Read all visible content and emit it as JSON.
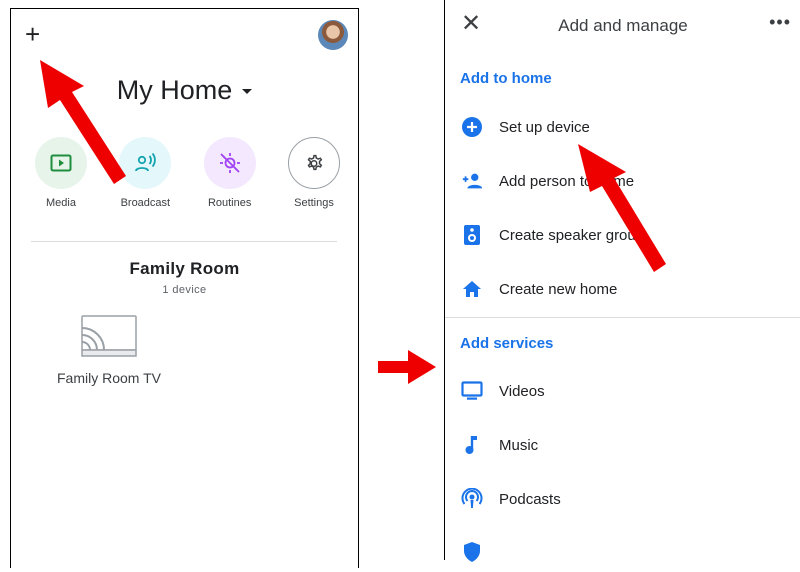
{
  "left": {
    "plus_label": "+",
    "home_title": "My Home",
    "shortcuts": [
      {
        "label": "Media",
        "icon": "play-icon",
        "bg": "#e6f4ea",
        "color": "#1e8e3e"
      },
      {
        "label": "Broadcast",
        "icon": "broadcast-icon",
        "bg": "#e4f7fb",
        "color": "#12a4af"
      },
      {
        "label": "Routines",
        "icon": "sun-slash-icon",
        "bg": "#f3e8fd",
        "color": "#a142f4"
      },
      {
        "label": "Settings",
        "icon": "gear-icon",
        "bg": "#ffffff",
        "color": "#3c4043"
      }
    ],
    "room": {
      "name": "Family Room",
      "count": "1 device"
    },
    "device": {
      "name": "Family Room TV",
      "icon": "cast-tv-icon"
    }
  },
  "right": {
    "close_label": "✕",
    "title": "Add and manage",
    "more_label": "•••",
    "section_add": "Add to home",
    "add_items": [
      {
        "label": "Set up device",
        "icon": "plus-circle-icon"
      },
      {
        "label": "Add person to home",
        "icon": "add-person-icon"
      },
      {
        "label": "Create speaker group",
        "icon": "speaker-icon"
      },
      {
        "label": "Create new home",
        "icon": "home-icon"
      }
    ],
    "section_services": "Add services",
    "service_items": [
      {
        "label": "Videos",
        "icon": "monitor-icon"
      },
      {
        "label": "Music",
        "icon": "music-note-icon"
      },
      {
        "label": "Podcasts",
        "icon": "podcast-icon"
      }
    ]
  },
  "colors": {
    "accent": "#1a73e8",
    "annotation_arrow": "#ee0000"
  }
}
